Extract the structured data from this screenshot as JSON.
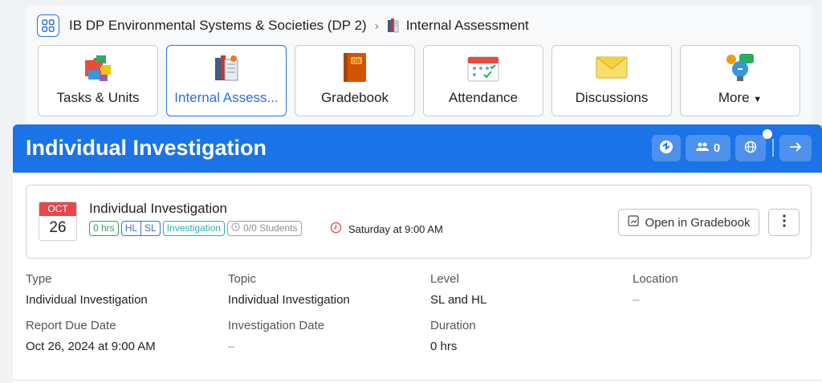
{
  "breadcrumb": {
    "course": "IB DP Environmental Systems & Societies (DP 2)",
    "separator": "›",
    "current": "Internal Assessment"
  },
  "nav_tiles": [
    {
      "label": "Tasks & Units",
      "icon": "puzzle-icon"
    },
    {
      "label": "Internal Assess...",
      "icon": "books-icon",
      "active": true
    },
    {
      "label": "Gradebook",
      "icon": "gradebook-icon"
    },
    {
      "label": "Attendance",
      "icon": "calendar-icon"
    },
    {
      "label": "Discussions",
      "icon": "envelope-icon"
    },
    {
      "label": "More",
      "icon": "lightbulb-icon"
    }
  ],
  "header": {
    "title": "Individual Investigation",
    "members_count": "0",
    "accent_color": "#1b73e8"
  },
  "event": {
    "month": "OCT",
    "day": "26",
    "title": "Individual Investigation",
    "tags": {
      "hours": "0 hrs",
      "level_hl": "HL",
      "level_sl": "SL",
      "type": "Investigation",
      "students": "0/0 Students"
    },
    "time": "Saturday at 9:00 AM",
    "open_gradebook_label": "Open in Gradebook"
  },
  "details": {
    "type": {
      "label": "Type",
      "value": "Individual Investigation"
    },
    "topic": {
      "label": "Topic",
      "value": "Individual Investigation"
    },
    "level": {
      "label": "Level",
      "value": "SL and HL"
    },
    "location": {
      "label": "Location",
      "value": "–"
    },
    "report_due": {
      "label": "Report Due Date",
      "value": "Oct 26, 2024 at 9:00 AM"
    },
    "investigation_date": {
      "label": "Investigation Date",
      "value": "–"
    },
    "duration": {
      "label": "Duration",
      "value": "0 hrs"
    }
  }
}
